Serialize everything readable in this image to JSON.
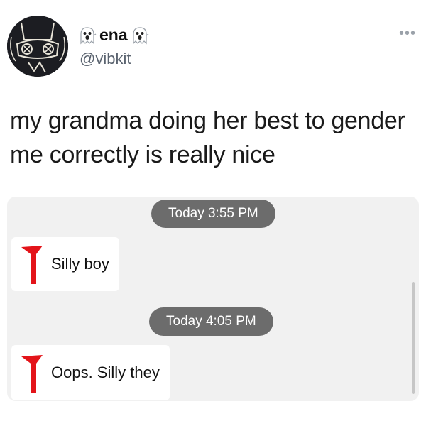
{
  "tweet": {
    "display_name": "ena",
    "name_emoji_icon": "ghost-icon",
    "handle": "@vibkit",
    "more_label": "•••",
    "text": "my grandma doing her best to gender me correctly is really nice"
  },
  "screenshot": {
    "messages": [
      {
        "timestamp": "Today 3:55 PM",
        "text": "Silly boy"
      },
      {
        "timestamp": "Today 4:05 PM",
        "text": "Oops. Silly they"
      }
    ]
  },
  "colors": {
    "pill": "#6c6c6c",
    "accent_flag": "#e3141a",
    "screenshot_bg": "#f1f1f1"
  }
}
